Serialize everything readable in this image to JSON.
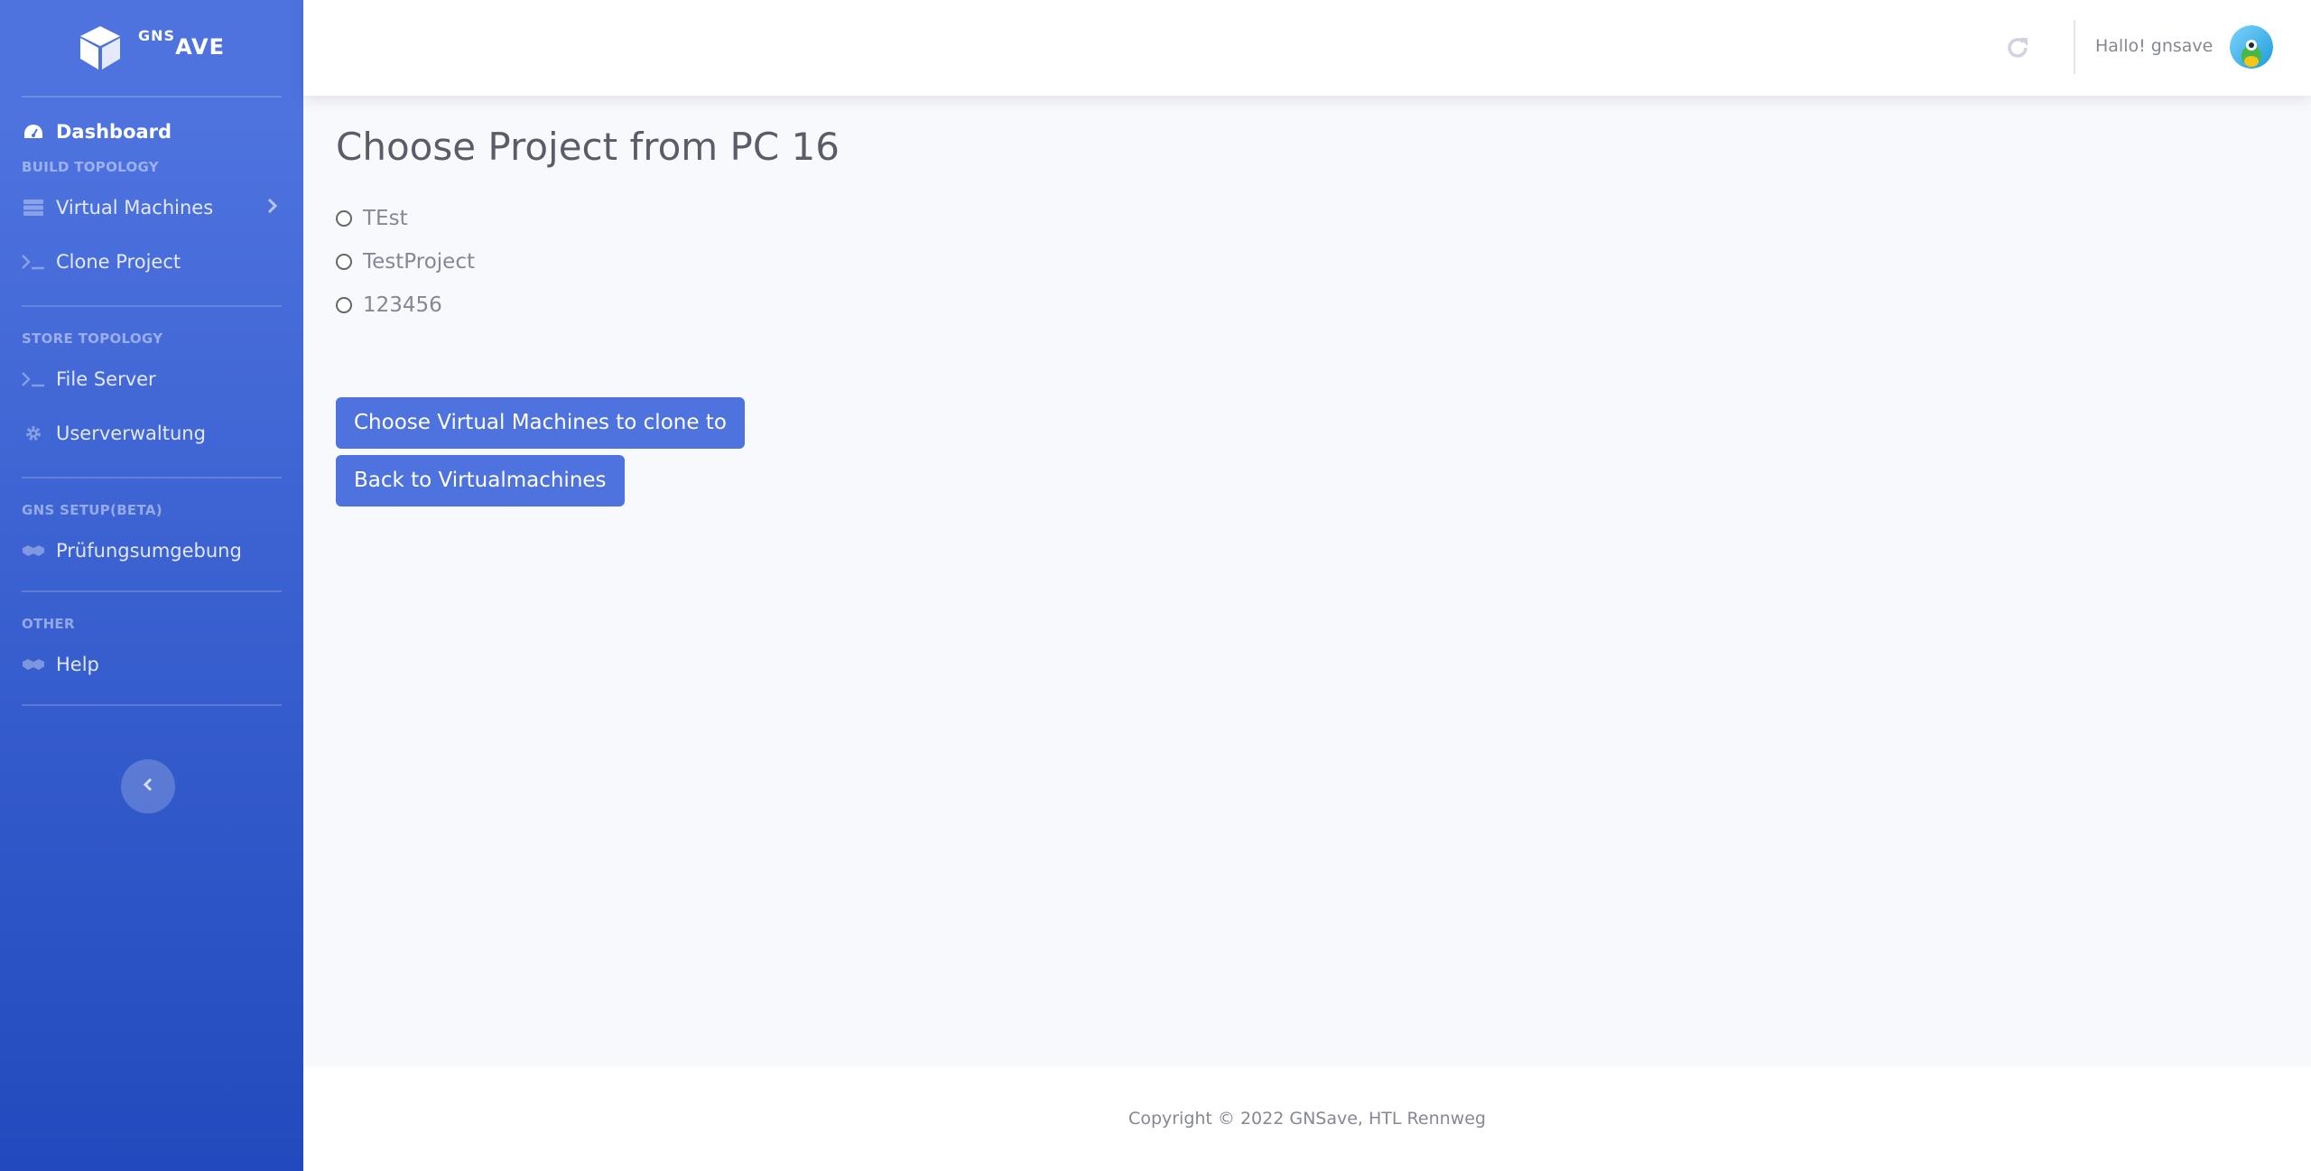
{
  "brand": {
    "prefix": "GNS",
    "suffix": "AVE"
  },
  "sidebar": {
    "dashboard": "Dashboard",
    "heading_build": "BUILD TOPOLOGY",
    "virtual_machines": "Virtual Machines",
    "clone_project": "Clone Project",
    "heading_store": "STORE TOPOLOGY",
    "file_server": "File Server",
    "userverwaltung": "Userverwaltung",
    "heading_gns": "GNS SETUP(BETA)",
    "pruefungsumgebung": "Prüfungsumgebung",
    "heading_other": "OTHER",
    "help": "Help"
  },
  "topbar": {
    "greeting": "Hallo! gnsave"
  },
  "main": {
    "title": "Choose Project from PC 16",
    "projects": [
      "TEst",
      "TestProject",
      "123456"
    ],
    "choose_button": "Choose Virtual Machines to clone to",
    "back_button": "Back to Virtualmachines"
  },
  "footer": {
    "copyright": "Copyright © 2022 GNSave, HTL Rennweg"
  },
  "colors": {
    "primary": "#4e73df",
    "sidebar_bottom": "#224abe"
  }
}
